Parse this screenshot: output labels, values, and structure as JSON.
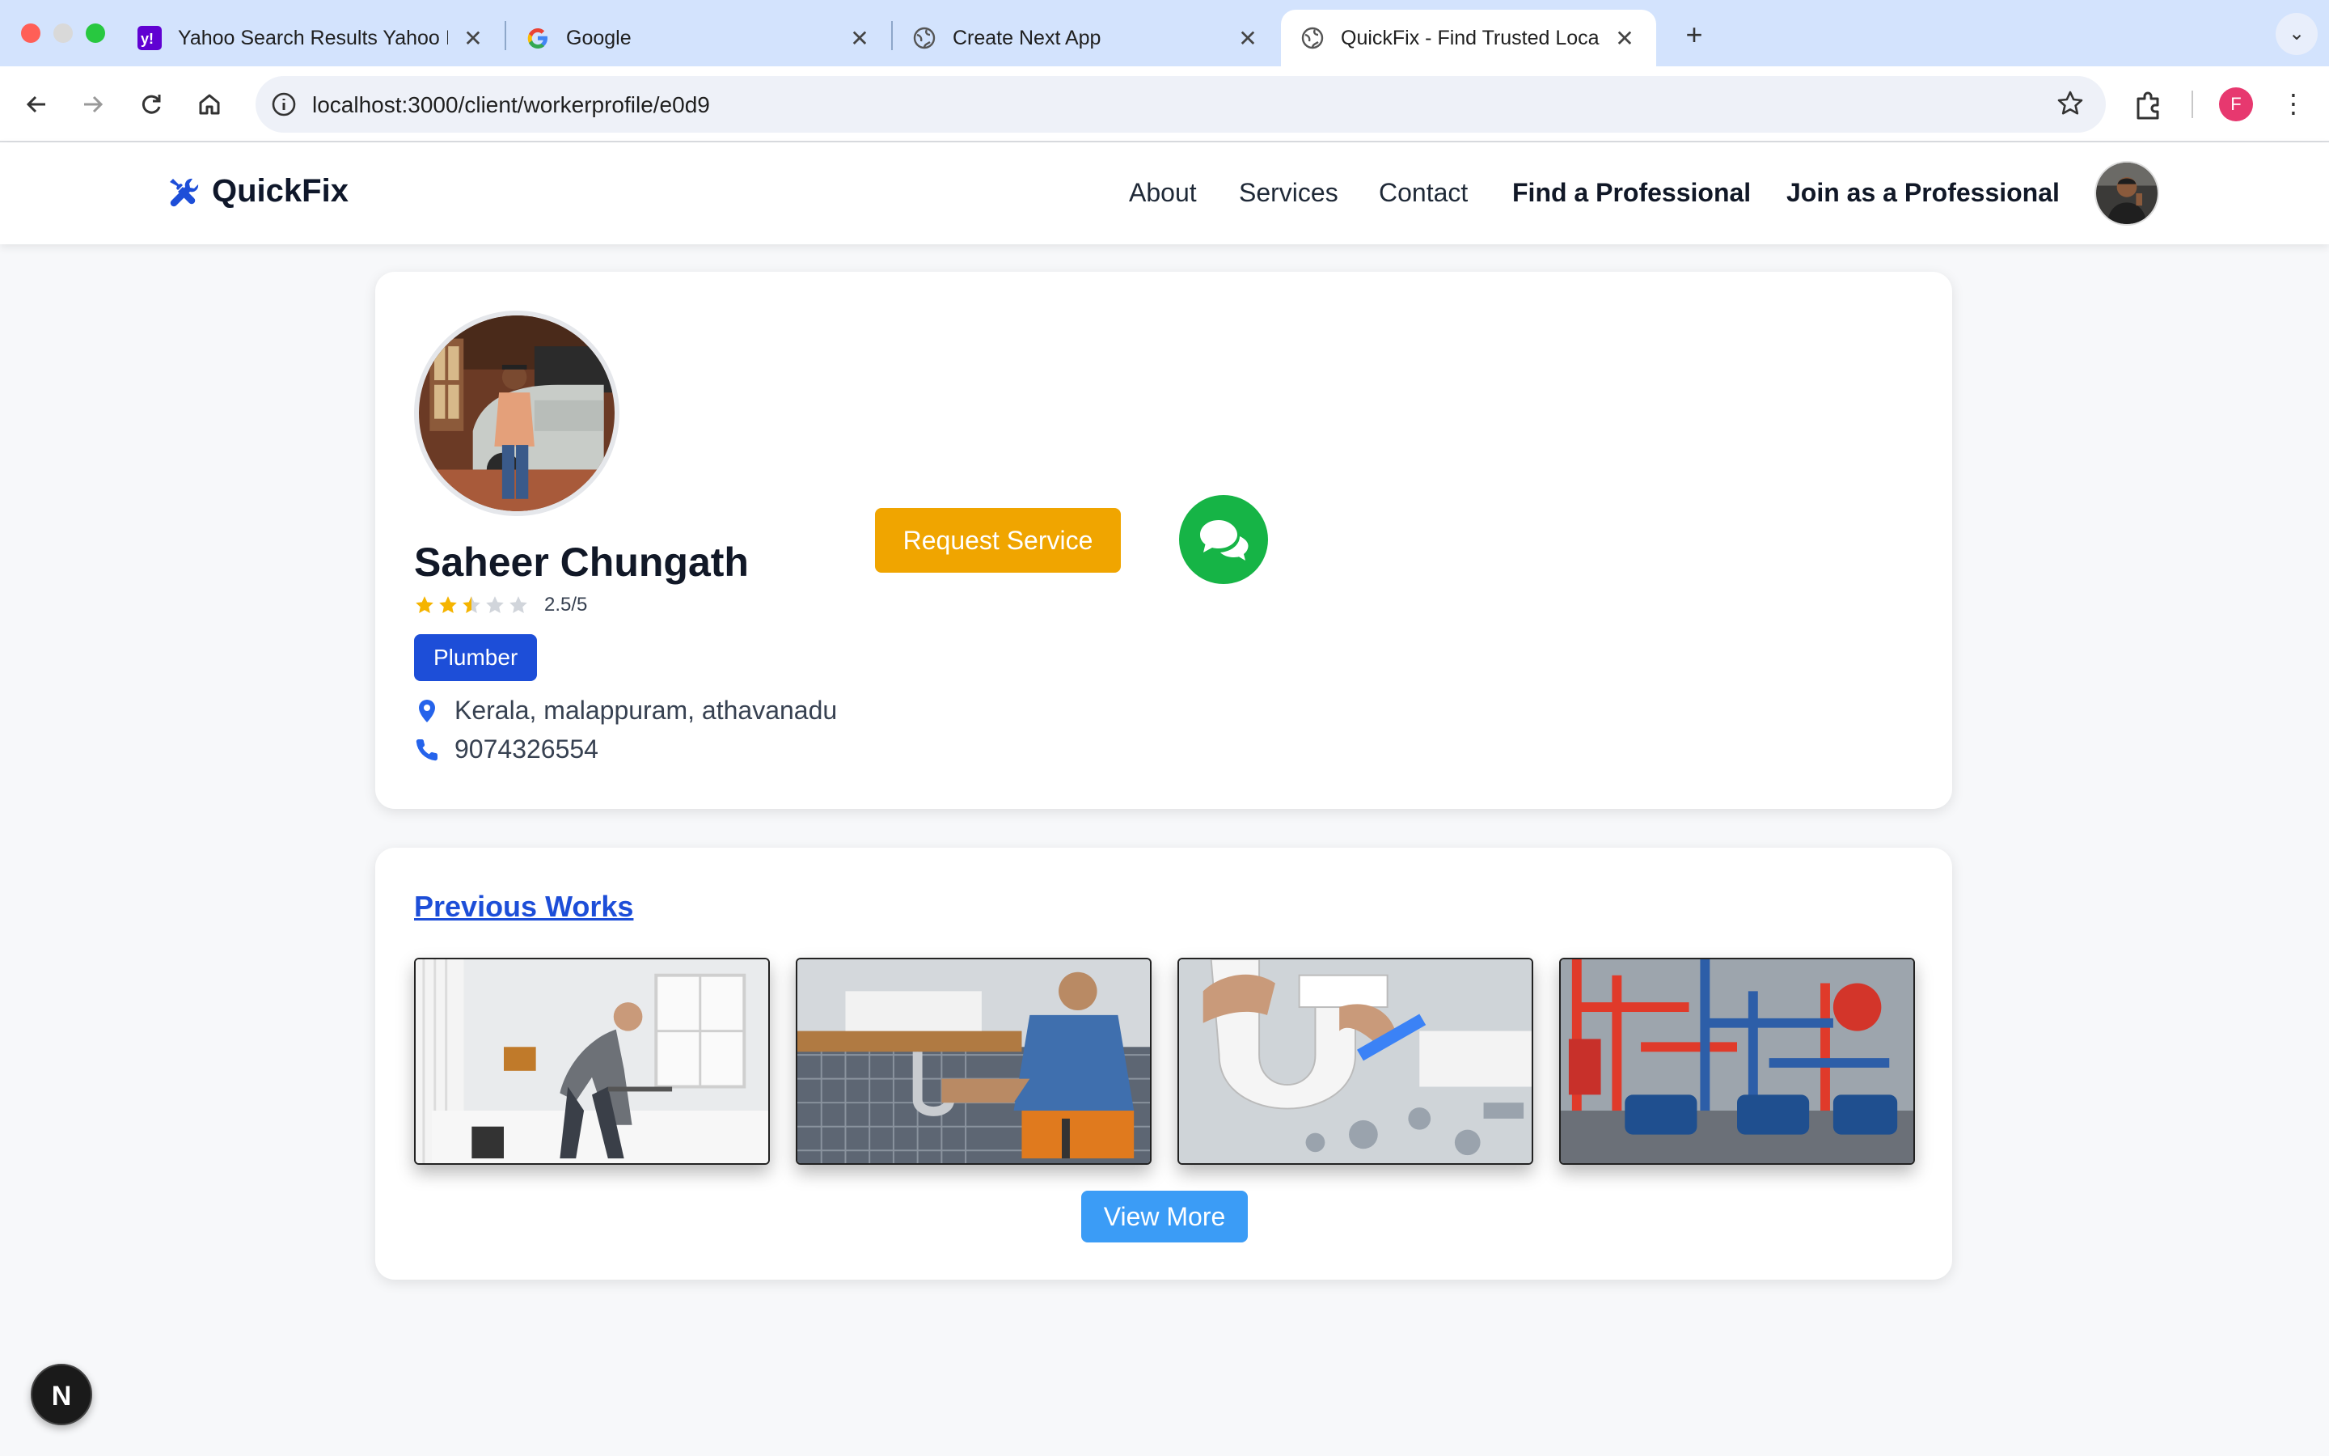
{
  "browser": {
    "tabs": [
      {
        "title": "Yahoo Search Results Yahoo I",
        "favicon": "yahoo-icon",
        "active": false
      },
      {
        "title": "Google",
        "favicon": "google-icon",
        "active": false
      },
      {
        "title": "Create Next App",
        "favicon": "globe-icon",
        "active": false
      },
      {
        "title": "QuickFix - Find Trusted Local",
        "favicon": "globe-icon",
        "active": true
      }
    ],
    "new_tab": "+",
    "url": "localhost:3000/client/workerprofile/e0d9",
    "profile_initial": "F"
  },
  "navbar": {
    "brand": "QuickFix",
    "links": [
      "About",
      "Services",
      "Contact"
    ],
    "find_professional": "Find a Professional",
    "join_professional": "Join as a Professional"
  },
  "profile": {
    "name": "Saheer Chungath",
    "rating_value": 2.5,
    "rating_text": "2.5/5",
    "category": "Plumber",
    "location": "Kerala, malappuram, athavanadu",
    "phone": "9074326554",
    "request_label": "Request Service"
  },
  "works": {
    "title": "Previous Works",
    "items": [
      "plumber-bathroom-photo",
      "plumber-sink-photo",
      "pipe-fittings-photo",
      "industrial-pipes-photo"
    ],
    "view_more": "View More"
  },
  "dev_badge": "N",
  "colors": {
    "brand_blue": "#1d4ed8",
    "request_orange": "#f0a500",
    "chat_green": "#16b446",
    "view_more_blue": "#3b9cf6",
    "star_yellow": "#f5b400"
  }
}
